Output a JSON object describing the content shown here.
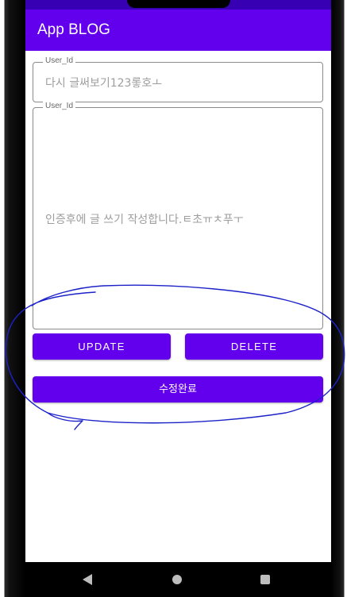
{
  "colors": {
    "primary": "#6200ee",
    "status_bar": "#3700b3",
    "annotation_stroke": "#1c22c8",
    "hint_text": "#9e9e9e"
  },
  "app_bar": {
    "title": "App BLOG"
  },
  "form": {
    "title_field": {
      "label": "User_Id",
      "value": "다시 글써보기123롷호ㅗ"
    },
    "content_field": {
      "label": "User_Id",
      "value": "인증후에 글 쓰기 작성합니다.ㅌ초ㅠㅊ푸ㅜ"
    }
  },
  "buttons": {
    "update_label": "UPDATE",
    "delete_label": "DELETE",
    "done_label": "수정완료"
  },
  "nav_bar": {
    "back_icon": "back-triangle-icon",
    "home_icon": "home-circle-icon",
    "recents_icon": "recents-square-icon"
  }
}
